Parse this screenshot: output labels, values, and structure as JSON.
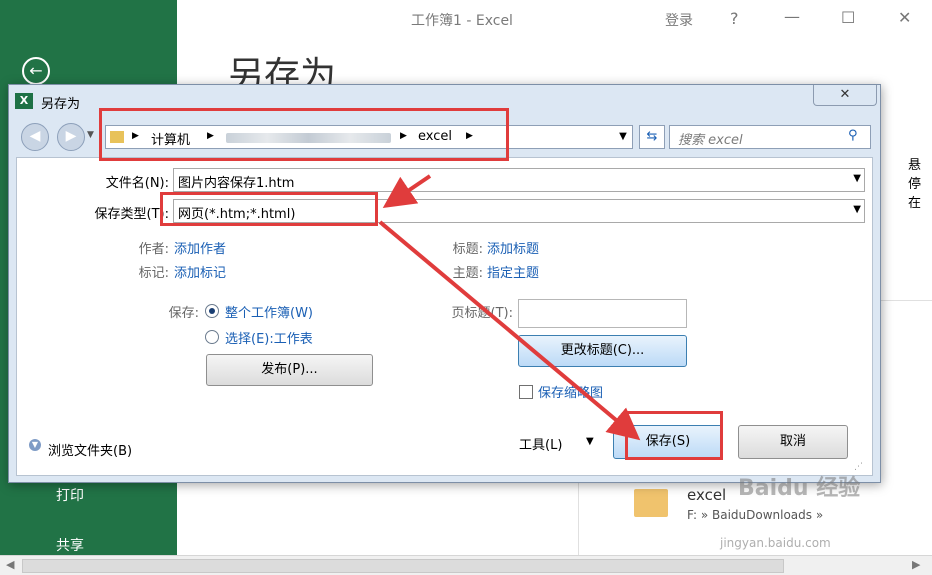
{
  "window": {
    "title": "工作簿1  -  Excel",
    "signin": "登录",
    "help": "?",
    "min": "—",
    "max": "☐",
    "close": "✕"
  },
  "backstage": {
    "back_icon": "arrow-left-icon",
    "heading": "另存为",
    "nav": [
      "打印",
      "共享"
    ],
    "right_pane_partial_text": "悬停在",
    "recent_item": {
      "name": "excel",
      "path": "F: » BaiduDownloads »"
    }
  },
  "dialog": {
    "title": "另存为",
    "icon_text": "X",
    "address": {
      "seg1": "计算机",
      "seg2": "excel"
    },
    "search_placeholder": "搜索 excel",
    "filename_label": "文件名(N):",
    "filename_value": "图片内容保存1.htm",
    "filetype_label": "保存类型(T):",
    "filetype_value": "网页(*.htm;*.html)",
    "author_label": "作者:",
    "author_link": "添加作者",
    "tags_label": "标记:",
    "tags_link": "添加标记",
    "title_label": "标题:",
    "title_link": "添加标题",
    "subject_label": "主题:",
    "subject_link": "指定主题",
    "save_label": "保存:",
    "option_workbook": "整个工作簿(W)",
    "option_sheet": "选择(E):工作表",
    "publish_button": "发布(P)...",
    "page_title_label": "页标题(T):",
    "page_title_value": "",
    "change_title_button": "更改标题(C)...",
    "save_thumbnail": "保存缩略图",
    "browse_folders": "浏览文件夹(B)",
    "tools": "工具(L)",
    "save_button": "保存(S)",
    "cancel_button": "取消"
  },
  "watermark": {
    "text": "Baidu 经验",
    "url": "jingyan.baidu.com"
  },
  "colors": {
    "excel_green": "#217346",
    "annotation_red": "#e03c3c",
    "link_blue": "#1a5fb4"
  }
}
